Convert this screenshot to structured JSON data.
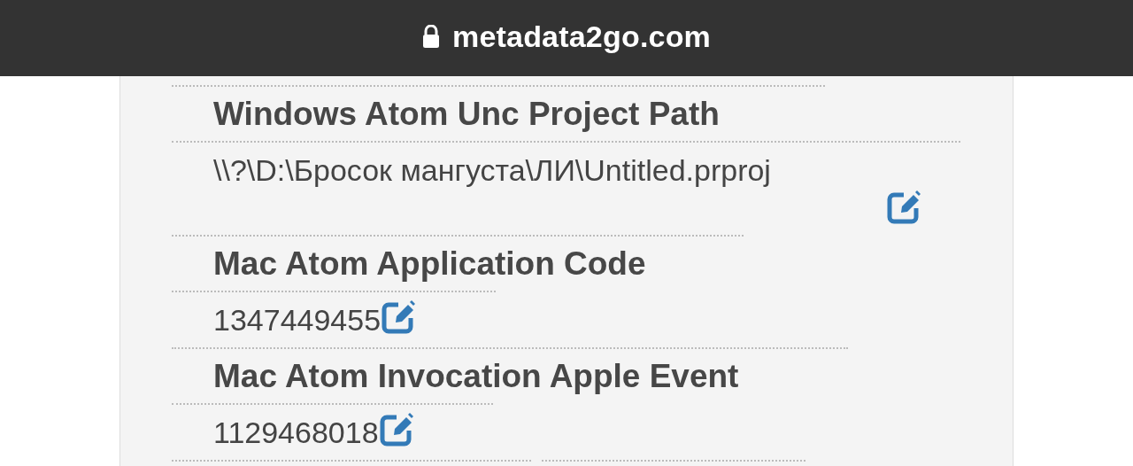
{
  "address_bar": {
    "url": "metadata2go.com",
    "secure": true
  },
  "fields": [
    {
      "name": "Windows Atom Unc Project Path",
      "value": "\\\\?\\D:\\Бросок мангуста\\ЛИ\\Untitled.prproj"
    },
    {
      "name": "Mac Atom Application Code",
      "value": "1347449455"
    },
    {
      "name": "Mac Atom Invocation Apple Event",
      "value": "1129468018"
    }
  ]
}
